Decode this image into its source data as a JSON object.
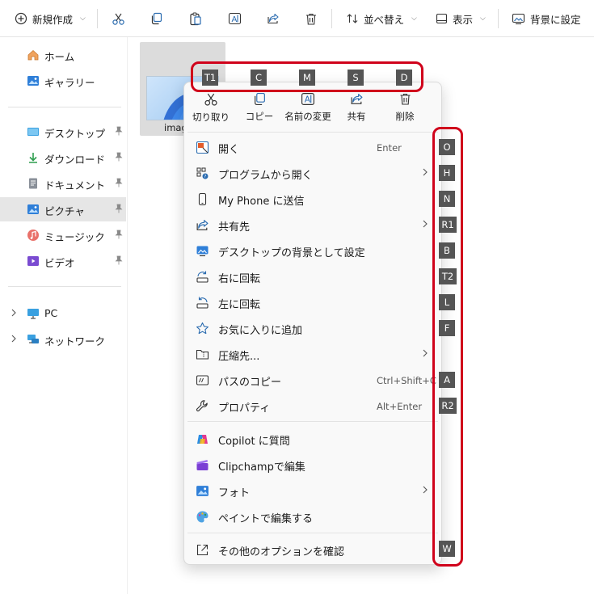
{
  "toolbar": {
    "new_label": "新規作成",
    "sort_label": "並べ替え",
    "view_label": "表示",
    "set_bg_label": "背景に設定"
  },
  "sidebar": {
    "items": [
      {
        "label": "ホーム"
      },
      {
        "label": "ギャラリー"
      },
      {
        "label": "デスクトップ"
      },
      {
        "label": "ダウンロード"
      },
      {
        "label": "ドキュメント"
      },
      {
        "label": "ピクチャ"
      },
      {
        "label": "ミュージック"
      },
      {
        "label": "ビデオ"
      },
      {
        "label": "PC"
      },
      {
        "label": "ネットワーク"
      }
    ]
  },
  "file": {
    "name_visible": "imag"
  },
  "context_menu": {
    "quick_actions": [
      {
        "label": "切り取り",
        "key": "T1"
      },
      {
        "label": "コピー",
        "key": "C"
      },
      {
        "label": "名前の変更",
        "key": "M"
      },
      {
        "label": "共有",
        "key": "S"
      },
      {
        "label": "削除",
        "key": "D"
      }
    ],
    "items": [
      {
        "label": "開く",
        "shortcut": "Enter",
        "key": "O"
      },
      {
        "label": "プログラムから開く",
        "key": "H"
      },
      {
        "label": "My Phone に送信",
        "key": "N"
      },
      {
        "label": "共有先",
        "key": "R1"
      },
      {
        "label": "デスクトップの背景として設定",
        "key": "B"
      },
      {
        "label": "右に回転",
        "key": "T2"
      },
      {
        "label": "左に回転",
        "key": "L"
      },
      {
        "label": "お気に入りに追加",
        "key": "F"
      },
      {
        "label": "圧縮先..."
      },
      {
        "label": "パスのコピー",
        "shortcut": "Ctrl+Shift+C",
        "key": "A"
      },
      {
        "label": "プロパティ",
        "shortcut": "Alt+Enter",
        "key": "R2"
      },
      {
        "label": "Copilot に質問"
      },
      {
        "label": "Clipchampで編集"
      },
      {
        "label": "フォト"
      },
      {
        "label": "ペイントで編集する"
      },
      {
        "label": "その他のオプションを確認",
        "key": "W"
      }
    ]
  },
  "colors": {
    "highlight_ring": "#d0021b",
    "badge_bg": "#555555",
    "selected_bg": "#e6e6e6"
  },
  "icons": [
    "plus-circle-icon",
    "scissors-icon",
    "copy-icon",
    "paste-icon",
    "rename-icon",
    "share-icon",
    "trash-icon",
    "sort-icon",
    "view-icon",
    "set-background-icon",
    "home-icon",
    "gallery-icon",
    "desktop-icon",
    "download-icon",
    "document-icon",
    "pictures-icon",
    "music-icon",
    "video-icon",
    "pc-icon",
    "network-icon",
    "pin-icon",
    "open-icon",
    "open-with-icon",
    "phone-icon",
    "rotate-right-icon",
    "rotate-left-icon",
    "star-icon",
    "folder-zip-icon",
    "copy-path-icon",
    "wrench-icon",
    "copilot-icon",
    "clipchamp-icon",
    "photos-icon",
    "paint-icon",
    "more-options-icon",
    "chevron-right-icon"
  ]
}
